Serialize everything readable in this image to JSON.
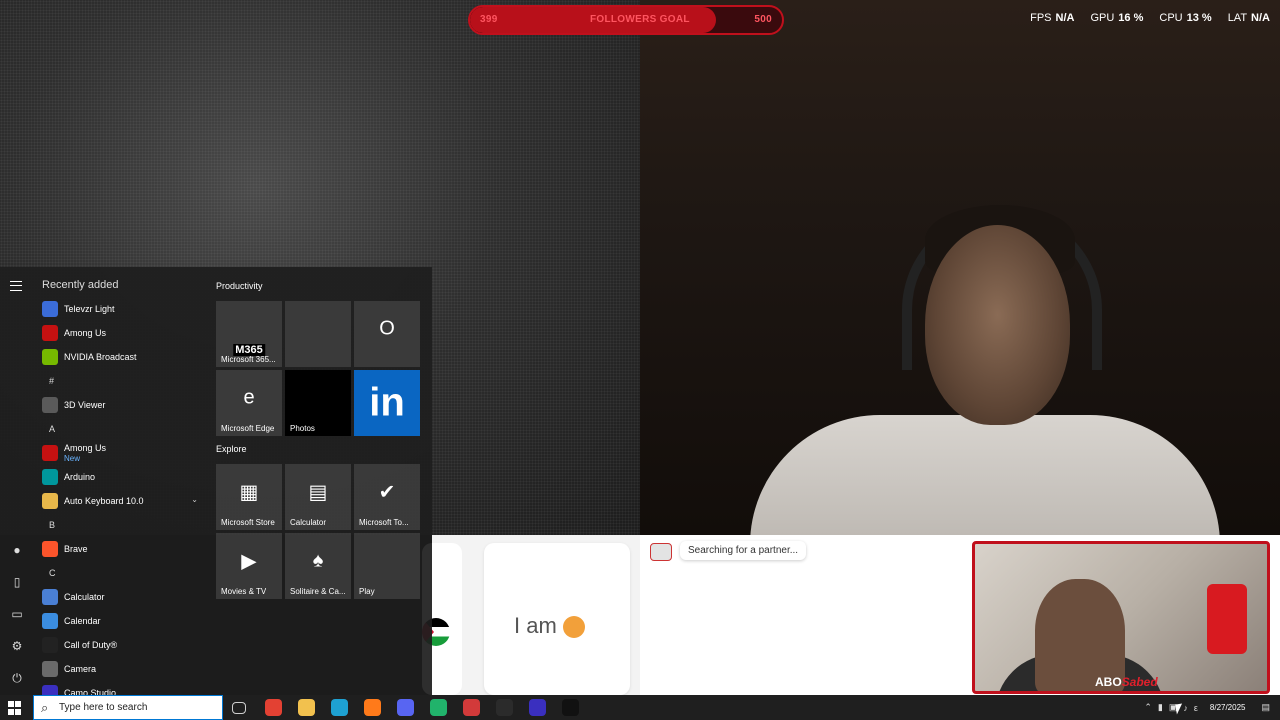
{
  "overlay": {
    "goal": {
      "current": "399",
      "label": "FOLLOWERS GOAL",
      "target": "500",
      "progress": 0.79
    },
    "perf": [
      {
        "name": "FPS",
        "value": "N/A"
      },
      {
        "name": "GPU",
        "value": "16 %"
      },
      {
        "name": "CPU",
        "value": "13 %"
      },
      {
        "name": "LAT",
        "value": "N/A"
      }
    ]
  },
  "chat": {
    "status": "Searching for a partner...",
    "card_text": "I am"
  },
  "webcam2": {
    "badge_main": "ABO",
    "badge_script": "Sabed"
  },
  "start_menu": {
    "recently_added_title": "Recently added",
    "recent": [
      {
        "name": "Televzr Light",
        "color": "#3b6cd8"
      },
      {
        "name": "Among Us",
        "color": "#c51111"
      },
      {
        "name": "NVIDIA Broadcast",
        "color": "#76b900"
      }
    ],
    "sections": [
      {
        "letter": "#",
        "apps": [
          {
            "name": "3D Viewer",
            "color": "#5a5a5a"
          }
        ]
      },
      {
        "letter": "A",
        "apps": [
          {
            "name": "Among Us",
            "sub": "New",
            "color": "#c51111"
          },
          {
            "name": "Arduino",
            "color": "#00979c"
          },
          {
            "name": "Auto Keyboard 10.0",
            "color": "#e8b84a",
            "folder": true
          }
        ]
      },
      {
        "letter": "B",
        "apps": [
          {
            "name": "Brave",
            "color": "#fb542b"
          }
        ]
      },
      {
        "letter": "C",
        "apps": [
          {
            "name": "Calculator",
            "color": "#4a7fd4"
          },
          {
            "name": "Calendar",
            "color": "#3b8de0"
          },
          {
            "name": "Call of Duty®",
            "color": "#222222"
          },
          {
            "name": "Camera",
            "color": "#6a6a6a"
          },
          {
            "name": "Camo Studio",
            "color": "#3a2fbf"
          }
        ]
      }
    ],
    "groups": [
      {
        "title": "Productivity",
        "tiles": [
          {
            "label": "Microsoft 365...",
            "bg": "rgba(80,80,80,0.55)",
            "glyph": "M365"
          },
          {
            "label": "",
            "bg": "rgba(80,80,80,0.55)",
            "glyph": ""
          },
          {
            "label": "",
            "bg": "rgba(80,80,80,0.55)",
            "glyph": "O"
          },
          {
            "label": "Microsoft Edge",
            "bg": "rgba(80,80,80,0.55)",
            "glyph": "e"
          },
          {
            "label": "Photos",
            "bg": "#000000",
            "glyph": ""
          },
          {
            "label": "",
            "bg": "#0a66c2",
            "glyph": "in"
          }
        ]
      },
      {
        "title": "Explore",
        "tiles": [
          {
            "label": "Microsoft Store",
            "bg": "rgba(80,80,80,0.55)",
            "glyph": "▦"
          },
          {
            "label": "Calculator",
            "bg": "rgba(80,80,80,0.55)",
            "glyph": "▤"
          },
          {
            "label": "Microsoft To...",
            "bg": "rgba(80,80,80,0.55)",
            "glyph": "✔"
          },
          {
            "label": "Movies & TV",
            "bg": "rgba(80,80,80,0.55)",
            "glyph": "▶"
          },
          {
            "label": "Solitaire & Ca...",
            "bg": "rgba(80,80,80,0.55)",
            "glyph": "♠"
          },
          {
            "label": "Play",
            "bg": "rgba(80,80,80,0.55)",
            "glyph": ""
          }
        ]
      }
    ]
  },
  "taskbar": {
    "search_placeholder": "Type here to search",
    "apps": [
      {
        "name": "task-view",
        "color": "#cfcfcf"
      },
      {
        "name": "chrome",
        "color": "#e34133"
      },
      {
        "name": "file-explorer",
        "color": "#f2c14e"
      },
      {
        "name": "edge",
        "color": "#1ea1d2"
      },
      {
        "name": "firefox",
        "color": "#ff7a1a"
      },
      {
        "name": "discord",
        "color": "#5865f2"
      },
      {
        "name": "app-green",
        "color": "#21b36b"
      },
      {
        "name": "app-red",
        "color": "#d23a3a"
      },
      {
        "name": "terminal",
        "color": "#2b2b2b"
      },
      {
        "name": "obs",
        "color": "#3a2fbf"
      },
      {
        "name": "app-dark",
        "color": "#111111"
      }
    ],
    "date": "8/27/2025"
  }
}
